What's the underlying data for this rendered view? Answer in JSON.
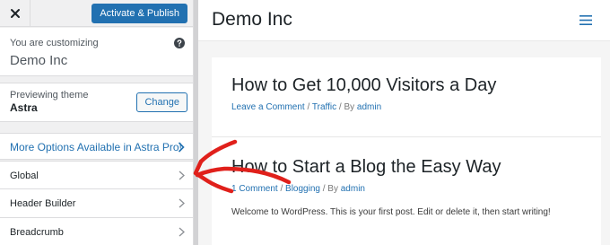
{
  "sidebar": {
    "activate_label": "Activate & Publish",
    "customizing_label": "You are customizing",
    "site_name": "Demo Inc",
    "previewing_label": "Previewing theme",
    "theme_name": "Astra",
    "change_label": "Change",
    "promo_label": "More Options Available in Astra Pro!",
    "sections": [
      {
        "label": "Global"
      },
      {
        "label": "Header Builder"
      },
      {
        "label": "Breadcrumb"
      }
    ]
  },
  "preview": {
    "site_title": "Demo Inc",
    "posts": [
      {
        "title": "How to Get 10,000 Visitors a Day",
        "comments": "Leave a Comment",
        "category": "Traffic",
        "by": "By",
        "author": "admin"
      },
      {
        "title": "How to Start a Blog the Easy Way",
        "comments": "1 Comment",
        "category": "Blogging",
        "by": "By",
        "author": "admin",
        "excerpt": "Welcome to WordPress. This is your first post. Edit or delete it, then start writing!"
      }
    ]
  },
  "icons": {
    "close": "close-icon",
    "help": "question-circle-icon",
    "chevron": "chevron-right-icon",
    "menu": "hamburger-menu-icon",
    "annotation": "red-arrow-annotation"
  },
  "colors": {
    "accent": "#2271b1",
    "arrow": "#e0201b"
  }
}
